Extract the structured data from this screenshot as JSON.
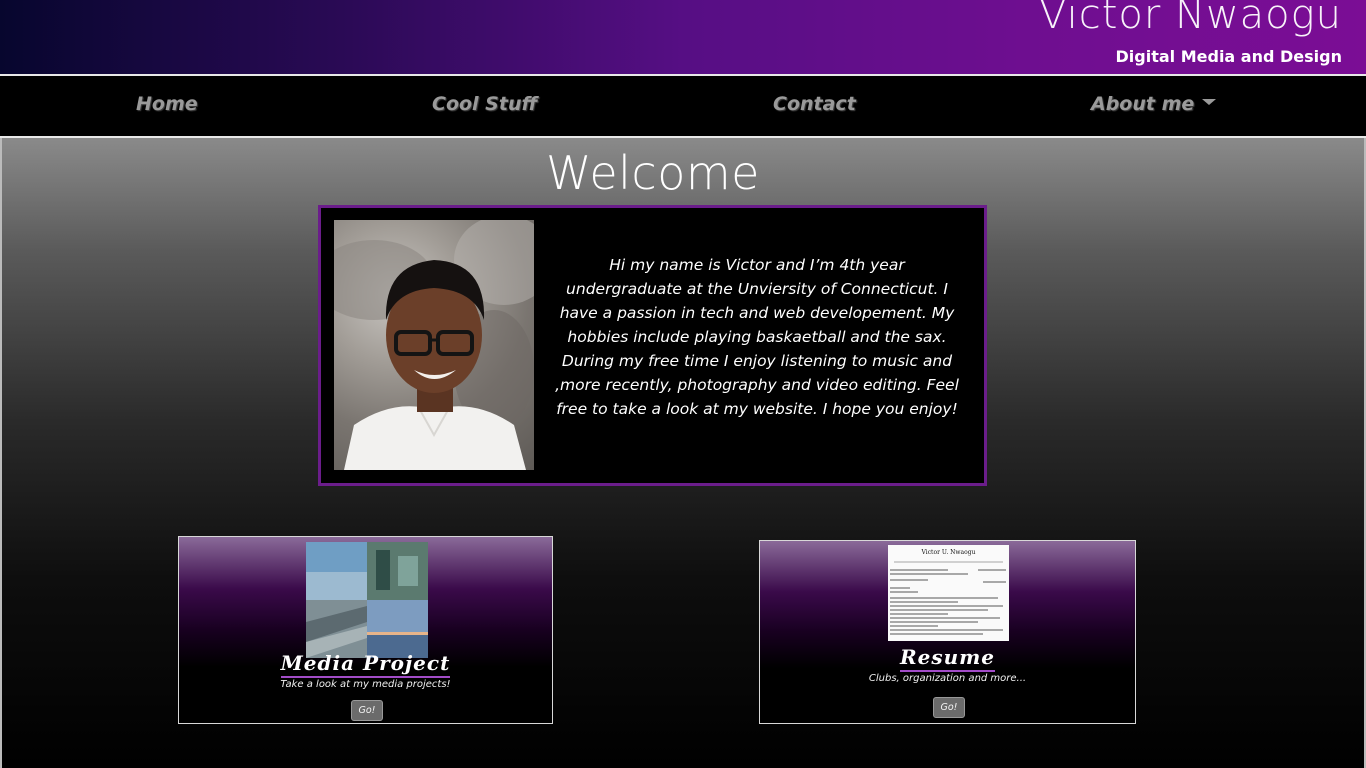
{
  "header": {
    "name": "Victor Nwaogu",
    "tagline": "Digital Media and Design"
  },
  "nav": {
    "home": "Home",
    "cool_stuff": "Cool Stuff",
    "contact": "Contact",
    "about": "About me"
  },
  "main": {
    "welcome": "Welcome",
    "intro": "Hi my name is Victor and I’m 4th year undergraduate at the Unviersity of Connecticut. I have a passion in tech and web developement. My hobbies include playing baskaetball and the sax. During my free time I enjoy listening to music and ,more recently, photography and video editing. Feel free to take a look at my website. I hope you enjoy!"
  },
  "cards": {
    "media": {
      "title": "Media Project",
      "subtitle": "Take a look at my media projects!",
      "button": "Go!"
    },
    "resume": {
      "title": "Resume",
      "subtitle": "Clubs, organization and more...",
      "button": "Go!",
      "doc_heading": "Victor U. Nwaogu"
    }
  },
  "colors": {
    "accent_purple": "#6b1d8b",
    "nav_text": "#9a9a9a"
  }
}
